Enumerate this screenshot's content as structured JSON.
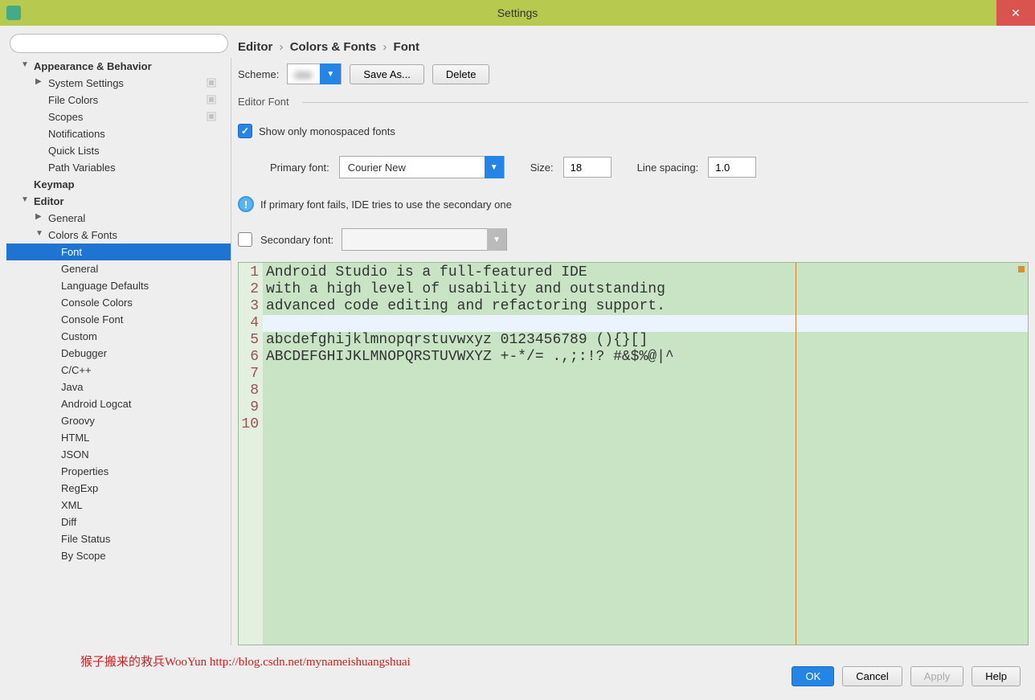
{
  "window": {
    "title": "Settings"
  },
  "breadcrumb": {
    "p0": "Editor",
    "p1": "Colors & Fonts",
    "p2": "Font"
  },
  "scheme": {
    "label": "Scheme:",
    "saveAs": "Save As...",
    "delete": "Delete"
  },
  "editorFont": {
    "legend": "Editor Font",
    "monospacedOnly": "Show only monospaced fonts",
    "primaryLabel": "Primary font:",
    "primaryValue": "Courier New",
    "sizeLabel": "Size:",
    "sizeValue": "18",
    "lineSpacingLabel": "Line spacing:",
    "lineSpacingValue": "1.0",
    "infoText": "If primary font fails, IDE tries to use the secondary one",
    "secondaryLabel": "Secondary font:"
  },
  "preview": {
    "lines": [
      "Android Studio is a full-featured IDE",
      "with a high level of usability and outstanding",
      "advanced code editing and refactoring support.",
      "",
      "abcdefghijklmnopqrstuvwxyz 0123456789 (){}[]",
      "ABCDEFGHIJKLMNOPQRSTUVWXYZ +-*/= .,;:!? #&$%@|^",
      "",
      "",
      "",
      ""
    ]
  },
  "sidebar": {
    "items": [
      {
        "label": "Appearance & Behavior",
        "level": 0,
        "arrow": "▼"
      },
      {
        "label": "System Settings",
        "level": 1,
        "arrow": "▶",
        "overlay": true
      },
      {
        "label": "File Colors",
        "level": 1,
        "overlay": true
      },
      {
        "label": "Scopes",
        "level": 1,
        "overlay": true
      },
      {
        "label": "Notifications",
        "level": 1
      },
      {
        "label": "Quick Lists",
        "level": 1
      },
      {
        "label": "Path Variables",
        "level": 1
      },
      {
        "label": "Keymap",
        "level": 0
      },
      {
        "label": "Editor",
        "level": 0,
        "arrow": "▼"
      },
      {
        "label": "General",
        "level": 1,
        "arrow": "▶"
      },
      {
        "label": "Colors & Fonts",
        "level": 1,
        "arrow": "▼"
      },
      {
        "label": "Font",
        "level": 2,
        "selected": true
      },
      {
        "label": "General",
        "level": 2
      },
      {
        "label": "Language Defaults",
        "level": 2
      },
      {
        "label": "Console Colors",
        "level": 2
      },
      {
        "label": "Console Font",
        "level": 2
      },
      {
        "label": "Custom",
        "level": 2
      },
      {
        "label": "Debugger",
        "level": 2
      },
      {
        "label": "C/C++",
        "level": 2
      },
      {
        "label": "Java",
        "level": 2
      },
      {
        "label": "Android Logcat",
        "level": 2
      },
      {
        "label": "Groovy",
        "level": 2
      },
      {
        "label": "HTML",
        "level": 2
      },
      {
        "label": "JSON",
        "level": 2
      },
      {
        "label": "Properties",
        "level": 2
      },
      {
        "label": "RegExp",
        "level": 2
      },
      {
        "label": "XML",
        "level": 2
      },
      {
        "label": "Diff",
        "level": 2
      },
      {
        "label": "File Status",
        "level": 2
      },
      {
        "label": "By Scope",
        "level": 2
      }
    ]
  },
  "footer": {
    "ok": "OK",
    "cancel": "Cancel",
    "apply": "Apply",
    "help": "Help"
  },
  "watermark": "猴子搬来的救兵WooYun http://blog.csdn.net/mynameishuangshuai"
}
